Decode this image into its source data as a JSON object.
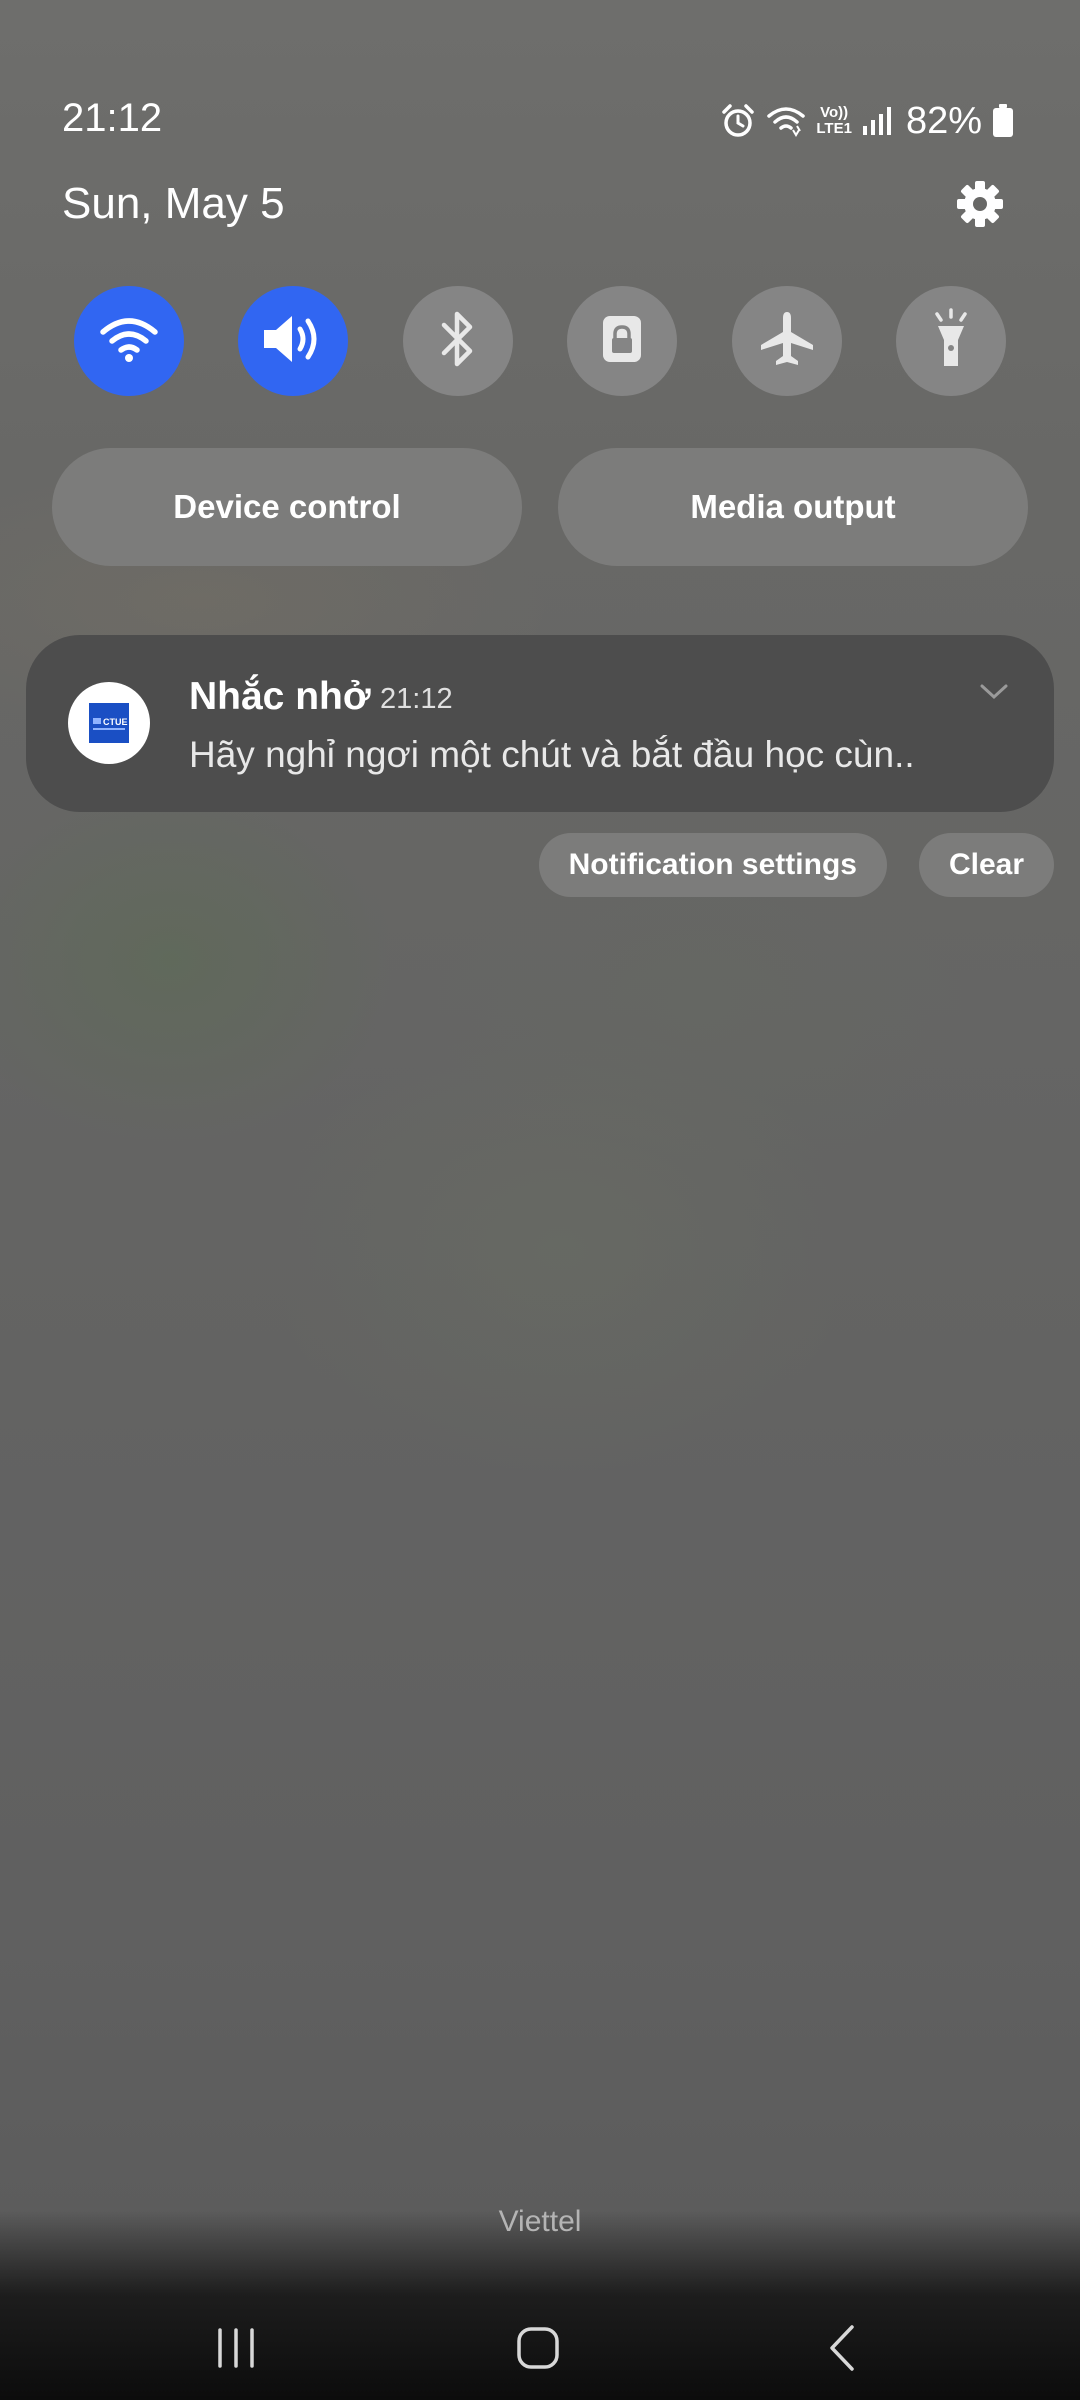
{
  "status_bar": {
    "time": "21:12",
    "network_label_top": "Vo))",
    "network_label_bottom": "LTE1",
    "battery_percent": "82%",
    "icons": [
      "alarm-icon",
      "wifi-icon",
      "volte-lte-icon",
      "signal-icon",
      "battery-icon"
    ]
  },
  "header": {
    "date": "Sun, May 5",
    "settings_icon": "gear-icon"
  },
  "quick_settings": [
    {
      "name": "wifi",
      "icon": "wifi-icon",
      "on": true
    },
    {
      "name": "sound",
      "icon": "sound-icon",
      "on": true
    },
    {
      "name": "bluetooth",
      "icon": "bluetooth-icon",
      "on": false
    },
    {
      "name": "rotation-lock",
      "icon": "lock-icon",
      "on": false
    },
    {
      "name": "airplane-mode",
      "icon": "airplane-icon",
      "on": false
    },
    {
      "name": "flashlight",
      "icon": "flashlight-icon",
      "on": false
    }
  ],
  "panels": {
    "device_control": "Device control",
    "media_output": "Media output"
  },
  "notification": {
    "app_logo_text": "CTUE",
    "title": "Nhắc nhở",
    "time": "21:12",
    "body": "Hãy nghỉ ngơi một chút và bắt đầu học cùn.."
  },
  "notification_actions": {
    "settings": "Notification settings",
    "clear": "Clear"
  },
  "carrier": "Viettel",
  "navigation": [
    "recent-apps",
    "home",
    "back"
  ],
  "colors": {
    "toggle_on": "#3166f2",
    "toggle_off": "#858585",
    "card": "#4d4d4d"
  }
}
